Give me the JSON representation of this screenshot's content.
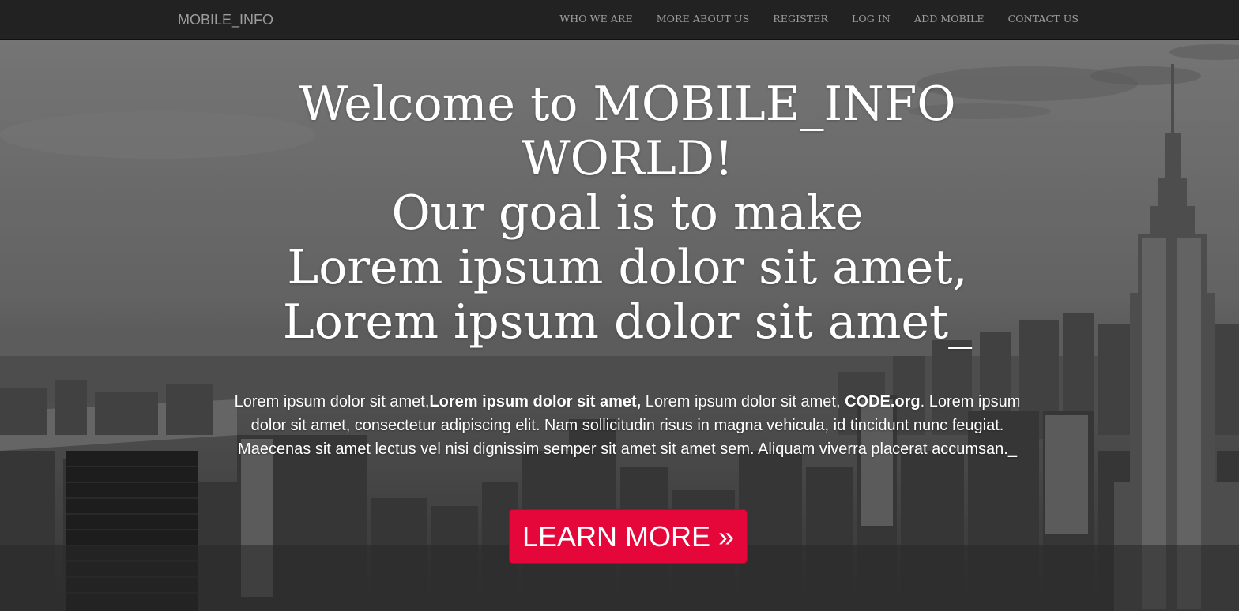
{
  "navbar": {
    "brand": "MOBILE_INFO",
    "items": [
      {
        "label": "WHO WE ARE"
      },
      {
        "label": "MORE ABOUT US"
      },
      {
        "label": "REGISTER"
      },
      {
        "label": "LOG IN"
      },
      {
        "label": "ADD MOBILE"
      },
      {
        "label": "CONTACT US"
      }
    ]
  },
  "hero": {
    "heading_lines": [
      "Welcome to MOBILE_INFO",
      "WORLD!",
      "Our goal is to make",
      "Lorem ipsum dolor sit amet,",
      "Lorem ipsum dolor sit amet_"
    ],
    "lead": {
      "part1": "Lorem ipsum dolor sit amet,",
      "bold1": "Lorem ipsum dolor sit amet,",
      "part2": " Lorem ipsum dolor sit amet, ",
      "bold2": "CODE.org",
      "part3": ". Lorem ipsum dolor sit amet, consectetur adipiscing elit. Nam sollicitudin risus in magna vehicula, id tincidunt nunc feugiat. Maecenas sit amet lectus vel nisi dignissim semper sit amet sit amet sem. Aliquam viverra placerat accumsan._"
    },
    "cta_label": "LEARN MORE »"
  },
  "colors": {
    "navbar_bg": "#222222",
    "nav_text": "#9d9d9d",
    "cta_bg": "#e5063a",
    "hero_text": "#ffffff"
  },
  "background": {
    "icon": "city-skyline-photo"
  }
}
